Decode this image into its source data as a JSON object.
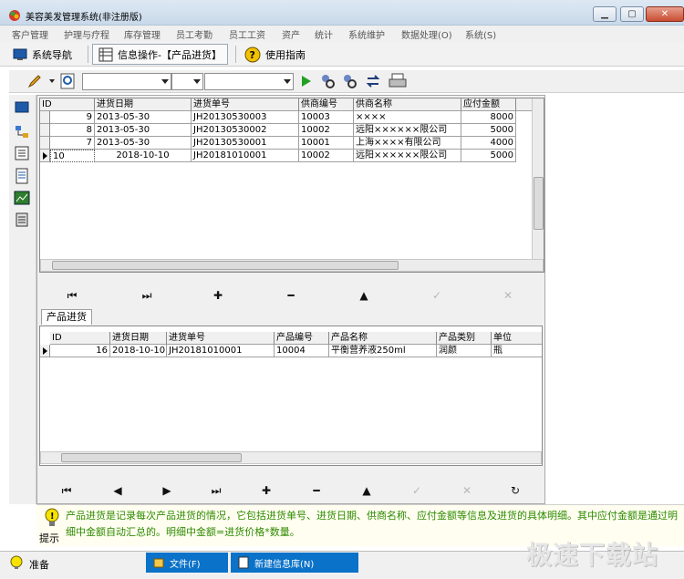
{
  "window": {
    "title": "美容美发管理系统(非注册版)",
    "minimize": "▁",
    "maximize": "▢",
    "close": "✕"
  },
  "menu": [
    "客户管理",
    "护理与疗程",
    "库存管理",
    "员工考勤",
    "员工工资",
    "资产",
    "统计",
    "系统维护",
    "数据处理(O)",
    "系统(S)"
  ],
  "nav": {
    "system_nav": "系统导航",
    "info_op": "信息操作-【产品进货】",
    "guide": "使用指南"
  },
  "purchase_grid": {
    "columns": [
      "ID",
      "进货日期",
      "进货单号",
      "供商编号",
      "供商名称",
      "应付金额"
    ],
    "rows": [
      {
        "id": "9",
        "date": "2013-05-30",
        "no": "JH20130530003",
        "supplier_id": "10003",
        "supplier": "××××",
        "amount": "8000"
      },
      {
        "id": "8",
        "date": "2013-05-30",
        "no": "JH20130530002",
        "supplier_id": "10002",
        "supplier": "远阳××××××限公司",
        "amount": "5000"
      },
      {
        "id": "7",
        "date": "2013-05-30",
        "no": "JH20130530001",
        "supplier_id": "10001",
        "supplier": "上海××××有限公司",
        "amount": "4000"
      },
      {
        "id": "10",
        "date": "2018-10-10",
        "no": "JH20181010001",
        "supplier_id": "10002",
        "supplier": "远阳××××××限公司",
        "amount": "5000"
      }
    ]
  },
  "detail_tab": "产品进货",
  "detail_grid": {
    "columns": [
      "ID",
      "进货日期",
      "进货单号",
      "产品编号",
      "产品名称",
      "产品类别",
      "单位"
    ],
    "rows": [
      {
        "id": "16",
        "date": "2018-10-10",
        "no": "JH20181010001",
        "product_id": "10004",
        "product": "平衡营养液250ml",
        "category": "润颜",
        "unit": "瓶"
      }
    ]
  },
  "hint": {
    "label": "提示",
    "text": "产品进货是记录每次产品进货的情况，它包括进货单号、进货日期、供商名称、应付金额等信息及进货的具体明细。其中应付金额是通过明细中金额自动汇总的。明细中金额=进货价格*数量。"
  },
  "status": {
    "ready": "准备",
    "task_file": "文件(F)",
    "task_newdb": "新建信息库(N)"
  },
  "watermark": "极速下载站"
}
